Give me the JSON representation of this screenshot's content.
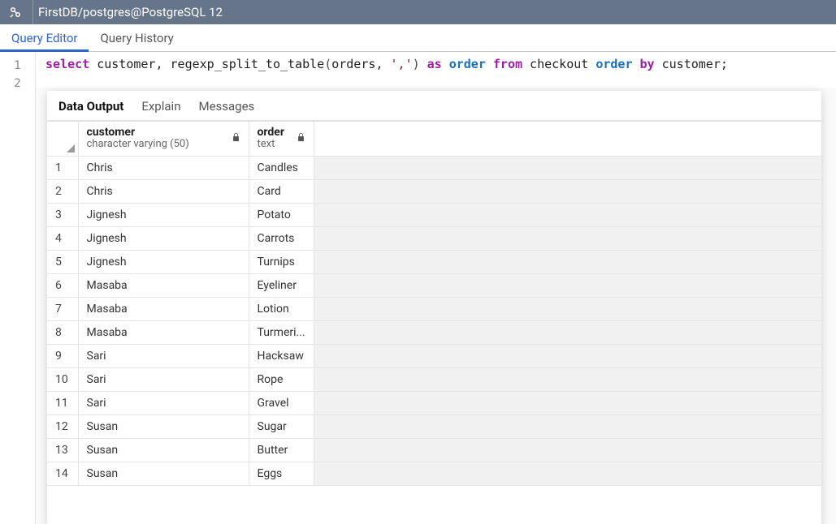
{
  "titlebar": {
    "title": "FirstDB/postgres@PostgreSQL 12"
  },
  "tabs": [
    {
      "label": "Query Editor",
      "active": true
    },
    {
      "label": "Query History",
      "active": false
    }
  ],
  "editor": {
    "line_numbers": [
      "1",
      "2"
    ],
    "sql_tokens": [
      {
        "t": "select",
        "c": "kw"
      },
      {
        "t": " customer",
        "c": "ident"
      },
      {
        "t": ",",
        "c": "ident"
      },
      {
        "t": " regexp_split_to_table",
        "c": "func"
      },
      {
        "t": "(",
        "c": "paren"
      },
      {
        "t": "orders",
        "c": "ident"
      },
      {
        "t": ",",
        "c": "ident"
      },
      {
        "t": " ','",
        "c": "str"
      },
      {
        "t": ")",
        "c": "paren"
      },
      {
        "t": " as",
        "c": "kw"
      },
      {
        "t": " order",
        "c": "bluekw"
      },
      {
        "t": " from",
        "c": "kw"
      },
      {
        "t": " checkout ",
        "c": "ident"
      },
      {
        "t": "order",
        "c": "bluekw"
      },
      {
        "t": " by",
        "c": "kw"
      },
      {
        "t": " customer;",
        "c": "ident"
      }
    ]
  },
  "output": {
    "tabs": [
      {
        "label": "Data Output",
        "active": true
      },
      {
        "label": "Explain",
        "active": false
      },
      {
        "label": "Messages",
        "active": false
      }
    ],
    "columns": [
      {
        "name": "customer",
        "type": "character varying (50)",
        "lock": true
      },
      {
        "name": "order",
        "type": "text",
        "lock": true
      }
    ],
    "rows": [
      {
        "n": "1",
        "customer": "Chris",
        "order": "Candles"
      },
      {
        "n": "2",
        "customer": "Chris",
        "order": "Card"
      },
      {
        "n": "3",
        "customer": "Jignesh",
        "order": "Potato"
      },
      {
        "n": "4",
        "customer": "Jignesh",
        "order": "Carrots"
      },
      {
        "n": "5",
        "customer": "Jignesh",
        "order": "Turnips"
      },
      {
        "n": "6",
        "customer": "Masaba",
        "order": "Eyeliner"
      },
      {
        "n": "7",
        "customer": "Masaba",
        "order": "Lotion"
      },
      {
        "n": "8",
        "customer": "Masaba",
        "order": "Turmeri..."
      },
      {
        "n": "9",
        "customer": "Sari",
        "order": "Hacksaw"
      },
      {
        "n": "10",
        "customer": "Sari",
        "order": "Rope"
      },
      {
        "n": "11",
        "customer": "Sari",
        "order": "Gravel"
      },
      {
        "n": "12",
        "customer": "Susan",
        "order": "Sugar"
      },
      {
        "n": "13",
        "customer": "Susan",
        "order": "Butter"
      },
      {
        "n": "14",
        "customer": "Susan",
        "order": "Eggs"
      }
    ]
  }
}
